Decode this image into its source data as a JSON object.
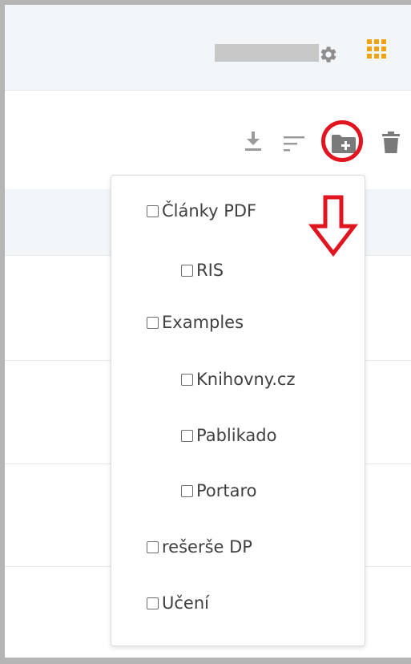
{
  "header": {
    "settings_icon": "gear-icon",
    "apps_icon": "apps-grid-icon",
    "apps_color": "#f0a20f"
  },
  "toolbar": {
    "icons": [
      "download-icon",
      "sort-icon",
      "folder-add-icon",
      "trash-icon"
    ],
    "highlight_color": "#e0151f"
  },
  "folder_menu": {
    "items": [
      {
        "label": "Články PDF",
        "level": 0,
        "checked": false
      },
      {
        "label": "RIS",
        "level": 1,
        "checked": false
      },
      {
        "label": "Examples",
        "level": 0,
        "checked": false
      },
      {
        "label": "Knihovny.cz",
        "level": 1,
        "checked": false
      },
      {
        "label": "Pablikado",
        "level": 1,
        "checked": false
      },
      {
        "label": "Portaro",
        "level": 1,
        "checked": false
      },
      {
        "label": "rešerše DP",
        "level": 0,
        "checked": false
      },
      {
        "label": "Učení",
        "level": 0,
        "checked": false
      }
    ]
  }
}
